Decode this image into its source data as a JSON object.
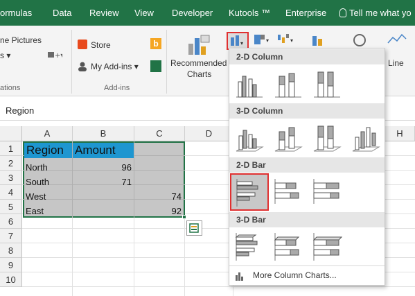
{
  "ribbon_tabs": [
    "ormulas",
    "Data",
    "Review",
    "View",
    "Developer",
    "Kutools ™",
    "Enterprise",
    "Tell me what yo"
  ],
  "ribbon": {
    "online_pictures": "ne Pictures",
    "store": "Store",
    "my_addins": "My Add-ins",
    "recommended_charts": [
      "Recommended",
      "Charts"
    ],
    "line": "Line",
    "group_illustrations": "ations",
    "group_addins": "Add-ins"
  },
  "formula_bar": {
    "content": "Region"
  },
  "grid": {
    "columns": [
      "A",
      "B",
      "C",
      "D",
      "H"
    ],
    "rows": [
      "1",
      "2",
      "3",
      "4",
      "5",
      "6",
      "7",
      "8",
      "9",
      "10"
    ],
    "header_row": {
      "region": "Region",
      "amount": "Amount"
    },
    "data": [
      {
        "region": "North",
        "b": "96",
        "c": ""
      },
      {
        "region": "South",
        "b": "71",
        "c": ""
      },
      {
        "region": "West",
        "b": "",
        "c": "74"
      },
      {
        "region": "East",
        "b": "",
        "c": "92"
      }
    ]
  },
  "dropdown": {
    "sections": [
      "2-D Column",
      "3-D Column",
      "2-D Bar",
      "3-D Bar"
    ],
    "more": "More Column Charts..."
  },
  "colors": {
    "accent": "#217346",
    "highlight_red": "#e03030",
    "header_fill": "#1e96d0",
    "selection": "#c6c6c6"
  }
}
